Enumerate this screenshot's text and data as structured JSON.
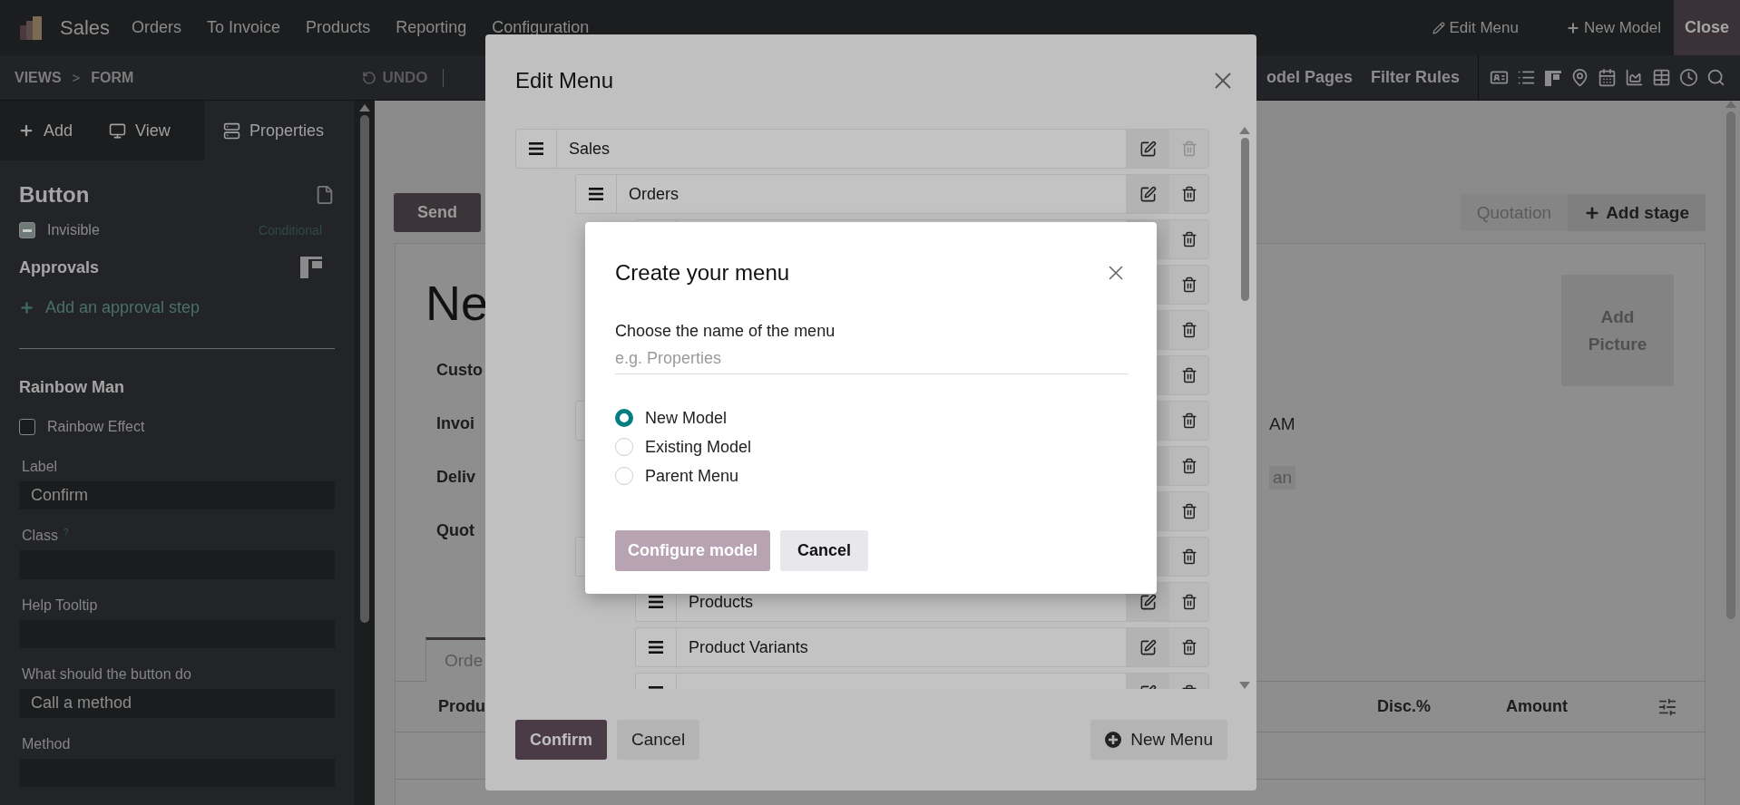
{
  "app_bar": {
    "app": "Sales",
    "menus": [
      "Orders",
      "To Invoice",
      "Products",
      "Reporting",
      "Configuration"
    ],
    "actions": [
      {
        "label": "Edit Menu",
        "kind": "edit"
      },
      {
        "label": "New Model",
        "kind": "add"
      }
    ],
    "close": "Close"
  },
  "toolbar": {
    "breadcrumb": [
      "VIEWS",
      "FORM"
    ],
    "separator": ">",
    "undo": "UNDO",
    "links": [
      "odel Pages",
      "Filter Rules"
    ]
  },
  "sidebar": {
    "tabs": [
      {
        "label": "Add",
        "kind": "add",
        "selected": false
      },
      {
        "label": "View",
        "kind": "view",
        "selected": false
      },
      {
        "label": "Properties",
        "kind": "properties",
        "selected": true
      }
    ],
    "title": "Button",
    "invisible": {
      "label": "Invisible",
      "mixed": true,
      "conditional": "Conditional"
    },
    "approvals": {
      "title": "Approvals",
      "add": "Add an approval step"
    },
    "rainbow": {
      "title": "Rainbow Man",
      "label": "Rainbow Effect",
      "checked": false
    },
    "fields": [
      {
        "label": "Label",
        "value": "Confirm"
      },
      {
        "label": "Class",
        "help": "?"
      },
      {
        "label": "Help Tooltip"
      },
      {
        "label": "What should the button do",
        "value": "Call a method"
      },
      {
        "label": "Method"
      }
    ]
  },
  "form": {
    "buttons": [
      "Send"
    ],
    "stages": [
      "Quotation"
    ],
    "add_stage": "Add stage",
    "title": "Ne",
    "fields": [
      {
        "label": "Custo"
      },
      {
        "label": "Invoi",
        "value": "AM",
        "kind": "text"
      },
      {
        "label": "Deliv",
        "value": "an",
        "kind": "tag"
      },
      {
        "label": "Quot"
      }
    ],
    "picture": "Add Picture",
    "tabs": [
      {
        "label": "Orde",
        "selected": true
      }
    ],
    "columns": [
      "Produ",
      "Disc.%",
      "Amount"
    ]
  },
  "edit_menu": {
    "title": "Edit Menu",
    "tree": [
      {
        "label": "Sales",
        "deletable": false,
        "children": [
          {
            "label": "Orders",
            "deletable": true,
            "children": [
              {
                "deletable": true
              },
              {
                "deletable": true
              },
              {
                "deletable": true
              },
              {
                "deletable": true
              }
            ]
          },
          {
            "deletable": true,
            "children": [
              {
                "deletable": true
              },
              {
                "deletable": true
              }
            ]
          },
          {
            "deletable": true,
            "children": [
              {
                "label": "Products",
                "deletable": true
              },
              {
                "label": "Product Variants",
                "deletable": true
              },
              {
                "deletable": true
              }
            ]
          }
        ]
      }
    ],
    "confirm": "Confirm",
    "cancel": "Cancel",
    "new_menu": "New Menu"
  },
  "create_menu": {
    "title": "Create your menu",
    "name_label": "Choose the name of the menu",
    "placeholder": "e.g. Properties",
    "options": [
      {
        "label": "New Model",
        "selected": true
      },
      {
        "label": "Existing Model",
        "selected": false
      },
      {
        "label": "Parent Menu",
        "selected": false
      }
    ],
    "configure": {
      "label": "Configure model",
      "disabled": true
    },
    "cancel": "Cancel"
  }
}
